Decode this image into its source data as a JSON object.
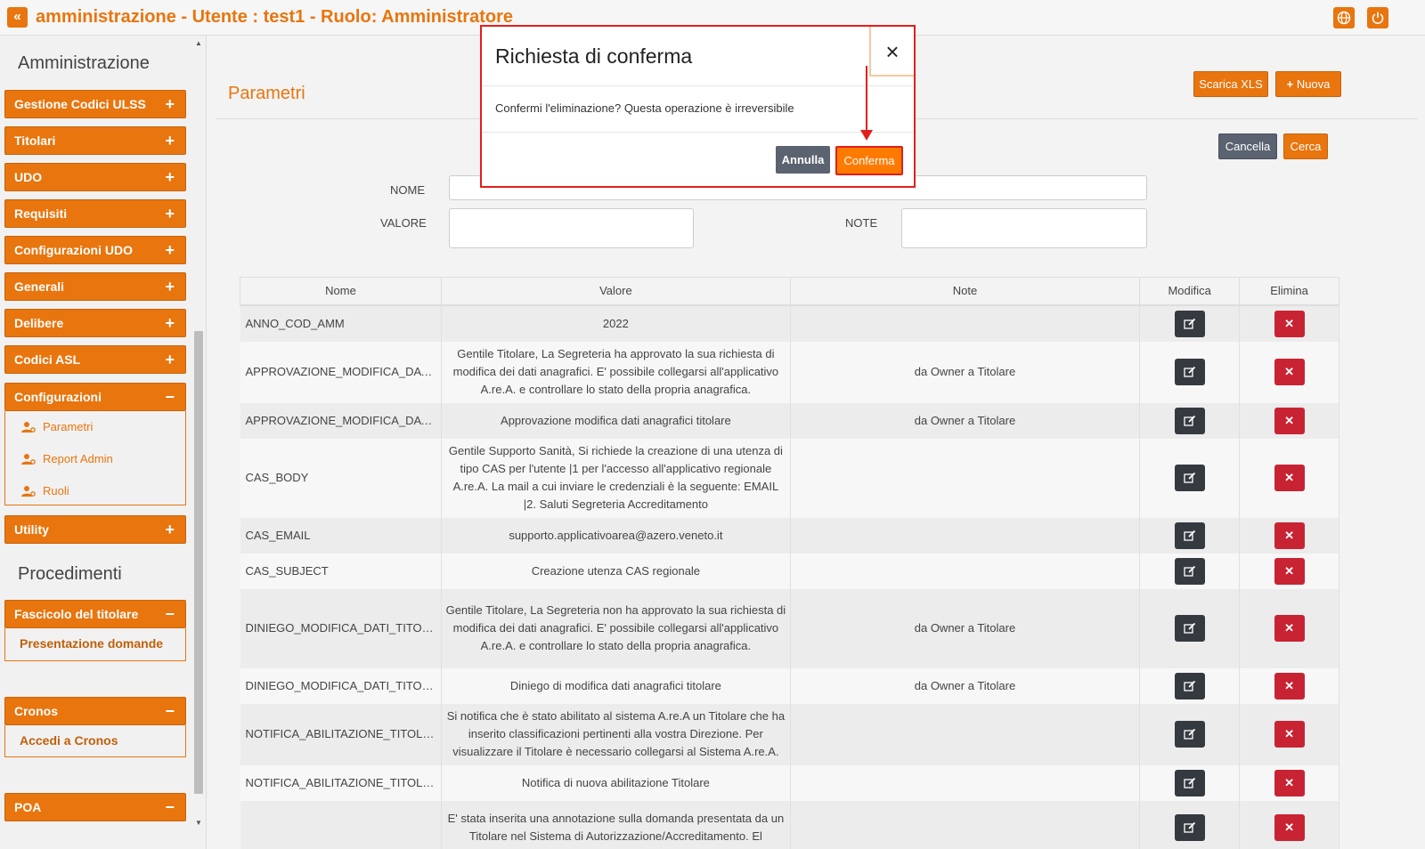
{
  "app": {
    "title": "amministrazione - Utente : test1 - Ruolo: Amministratore"
  },
  "sidebar": {
    "section_admin": "Amministrazione",
    "menus": [
      {
        "label": "Gestione Codici ULSS",
        "sign": "+"
      },
      {
        "label": "Titolari",
        "sign": "+"
      },
      {
        "label": "UDO",
        "sign": "+"
      },
      {
        "label": "Requisiti",
        "sign": "+"
      },
      {
        "label": "Configurazioni UDO",
        "sign": "+"
      },
      {
        "label": "Generali",
        "sign": "+"
      },
      {
        "label": "Delibere",
        "sign": "+"
      },
      {
        "label": "Codici ASL",
        "sign": "+"
      }
    ],
    "configurazioni": {
      "label": "Configurazioni",
      "sign": "−",
      "items": [
        "Parametri",
        "Report Admin",
        "Ruoli"
      ]
    },
    "utility": {
      "label": "Utility",
      "sign": "+"
    },
    "section_proc": "Procedimenti",
    "fascicolo": {
      "label": "Fascicolo del titolare",
      "sign": "−",
      "link": "Presentazione domande"
    },
    "cronos": {
      "label": "Cronos",
      "sign": "−",
      "link": "Accedi a Cronos"
    },
    "poa": {
      "label": "POA",
      "sign": "−"
    }
  },
  "main": {
    "page_title": "Parametri",
    "buttons": {
      "scarica": "Scarica XLS",
      "nuova": "Nuova",
      "cancella": "Cancella",
      "cerca": "Cerca"
    },
    "form": {
      "nome_label": "NOME",
      "valore_label": "VALORE",
      "note_label": "NOTE"
    },
    "table": {
      "headers": [
        "Nome",
        "Valore",
        "Note",
        "Modifica",
        "Elimina"
      ],
      "rows": [
        {
          "nome": "ANNO_COD_AMM",
          "valore": "2022",
          "note": ""
        },
        {
          "nome": "APPROVAZIONE_MODIFICA_DATI_...",
          "valore": "Gentile Titolare, La Segreteria ha approvato la sua richiesta di modifica dei dati anagrafici. E' possibile collegarsi all'applicativo A.re.A. e controllare lo stato della propria anagrafica.",
          "note": "da Owner a Titolare"
        },
        {
          "nome": "APPROVAZIONE_MODIFICA_DATI_...",
          "valore": "Approvazione modifica dati anagrafici titolare",
          "note": "da Owner a Titolare"
        },
        {
          "nome": "CAS_BODY",
          "valore": "Gentile Supporto Sanità, Si richiede la creazione di una utenza di tipo CAS per l'utente |1 per l'accesso all'applicativo regionale A.re.A. La mail a cui inviare le credenziali è la seguente: EMAIL |2. Saluti Segreteria Accreditamento",
          "note": ""
        },
        {
          "nome": "CAS_EMAIL",
          "valore": "supporto.applicativoarea@azero.veneto.it",
          "note": ""
        },
        {
          "nome": "CAS_SUBJECT",
          "valore": "Creazione utenza CAS regionale",
          "note": ""
        },
        {
          "nome": "DINIEGO_MODIFICA_DATI_TITOLA...",
          "valore": "Gentile Titolare, La Segreteria non ha approvato la sua richiesta di modifica dei dati anagrafici. E' possibile collegarsi all'applicativo A.re.A. e controllare lo stato della propria anagrafica.",
          "note": "da Owner a Titolare"
        },
        {
          "nome": "DINIEGO_MODIFICA_DATI_TITOLA...",
          "valore": "Diniego di modifica dati anagrafici titolare",
          "note": "da Owner a Titolare"
        },
        {
          "nome": "NOTIFICA_ABILITAZIONE_TITOLAR...",
          "valore": "Si notifica che è stato abilitato al sistema A.re.A un Titolare che ha inserito classificazioni pertinenti alla vostra Direzione. Per visualizzare il Titolare è necessario collegarsi al Sistema A.re.A.",
          "note": ""
        },
        {
          "nome": "NOTIFICA_ABILITAZIONE_TITOLAR...",
          "valore": "Notifica di nuova abilitazione Titolare",
          "note": ""
        },
        {
          "nome": "",
          "valore": "E' stata inserita una annotazione sulla domanda presentata da un Titolare nel Sistema di Autorizzazione/Accreditamento. El",
          "note": ""
        }
      ]
    }
  },
  "modal": {
    "title": "Richiesta di conferma",
    "close": "×",
    "message": "Confermi l'eliminazione? Questa operazione è irreversibile",
    "cancel": "Annulla",
    "confirm": "Conferma"
  },
  "colors": {
    "accent": "#e8750e",
    "danger": "#c82333",
    "dark": "#343a40",
    "highlight": "#e0201c"
  }
}
